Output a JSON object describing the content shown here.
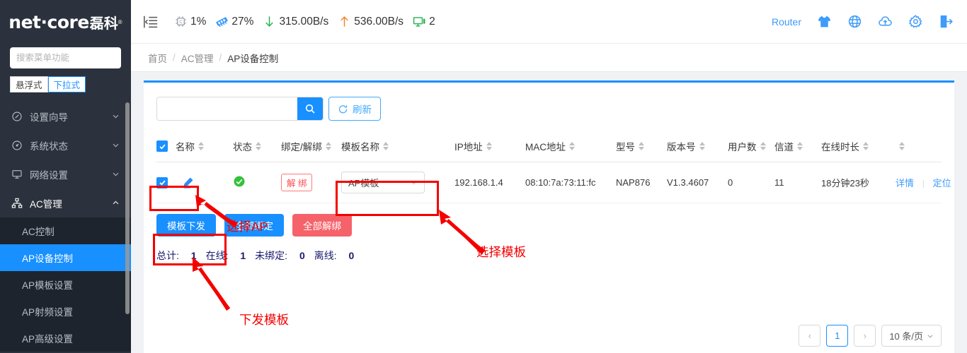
{
  "sidebar": {
    "brand": {
      "name": "net·core",
      "cn": "磊科",
      "reg": "®"
    },
    "search": {
      "value": "",
      "placeholder": "搜索菜单功能",
      "icon": "search-icon"
    },
    "modes": [
      {
        "label": "悬浮式",
        "active": false
      },
      {
        "label": "下拉式",
        "active": true
      }
    ],
    "menu": [
      {
        "label": "设置向导",
        "icon": "compass-icon",
        "chevron": "chevron-down-icon",
        "open": false
      },
      {
        "label": "系统状态",
        "icon": "gauge-icon",
        "chevron": "chevron-down-icon",
        "open": false
      },
      {
        "label": "网络设置",
        "icon": "monitor-icon",
        "chevron": "chevron-down-icon",
        "open": false
      },
      {
        "label": "AC管理",
        "icon": "sitemap-icon",
        "chevron": "chevron-up-icon",
        "open": true
      }
    ],
    "submenu": [
      {
        "label": "AC控制",
        "selected": false
      },
      {
        "label": "AP设备控制",
        "selected": true
      },
      {
        "label": "AP模板设置",
        "selected": false
      },
      {
        "label": "AP射频设置",
        "selected": false
      },
      {
        "label": "AP高级设置",
        "selected": false
      }
    ]
  },
  "topbar": {
    "collapse_icon": "collapse-menu-icon",
    "stats": [
      {
        "icon": "cpu-icon",
        "value": "1%"
      },
      {
        "icon": "memory-icon",
        "value": "27%"
      },
      {
        "icon": "download-arrow-icon",
        "value": "315.00B/s"
      },
      {
        "icon": "upload-arrow-icon",
        "value": "536.00B/s"
      },
      {
        "icon": "clients-monitor-icon",
        "value": "2"
      }
    ],
    "router_label": "Router",
    "icons": [
      "tshirt-icon",
      "globe-icon",
      "cloud-upload-icon",
      "gear-icon",
      "logout-icon"
    ],
    "accent": "#3d9bfb"
  },
  "breadcrumb": {
    "items": [
      "首页",
      "AC管理",
      "AP设备控制"
    ],
    "separator": "/"
  },
  "toolbar": {
    "search_value": "",
    "search_placeholder": "",
    "search_icon": "search-icon",
    "refresh_label": "刷新",
    "refresh_icon": "refresh-icon"
  },
  "table": {
    "header_checkbox_checked": true,
    "columns": [
      {
        "label": "名称",
        "sortable": true
      },
      {
        "label": "状态",
        "sortable": true
      },
      {
        "label": "绑定/解绑",
        "sortable": true
      },
      {
        "label": "模板名称",
        "sortable": true
      },
      {
        "label": "IP地址",
        "sortable": true
      },
      {
        "label": "MAC地址",
        "sortable": true
      },
      {
        "label": "型号",
        "sortable": true
      },
      {
        "label": "版本号",
        "sortable": true
      },
      {
        "label": "用户数",
        "sortable": true
      },
      {
        "label": "信道",
        "sortable": true
      },
      {
        "label": "在线时长",
        "sortable": true
      },
      {
        "label": "",
        "sortable": true
      }
    ],
    "rows": [
      {
        "checked": true,
        "edit_icon": "edit-pencil-icon",
        "status_icon": "status-online-icon",
        "bind_label": "解 绑",
        "template": "AP模板",
        "ip": "192.168.1.4",
        "mac": "08:10:7a:73:11:fc",
        "model": "NAP876",
        "version": "V1.3.4607",
        "users": "0",
        "channel": "11",
        "uptime": "18分钟23秒",
        "action_detail": "详情",
        "action_locate": "定位"
      }
    ]
  },
  "actions": [
    {
      "label": "模板下发",
      "style": "blue"
    },
    {
      "label": "全部绑定",
      "style": "blue"
    },
    {
      "label": "全部解绑",
      "style": "red"
    }
  ],
  "summary": [
    {
      "label": "总计:",
      "value": "1"
    },
    {
      "label": "在线:",
      "value": "1"
    },
    {
      "label": "未绑定:",
      "value": "0"
    },
    {
      "label": "离线:",
      "value": "0"
    }
  ],
  "pagination": {
    "prev": "‹",
    "current": "1",
    "next": "›",
    "page_size": "10 条/页",
    "chevron": "chevron-down-icon"
  },
  "annotations": {
    "color": "#f40000",
    "labels": [
      {
        "text": "选择AP"
      },
      {
        "text": "选择模板"
      },
      {
        "text": "下发模板"
      }
    ]
  }
}
